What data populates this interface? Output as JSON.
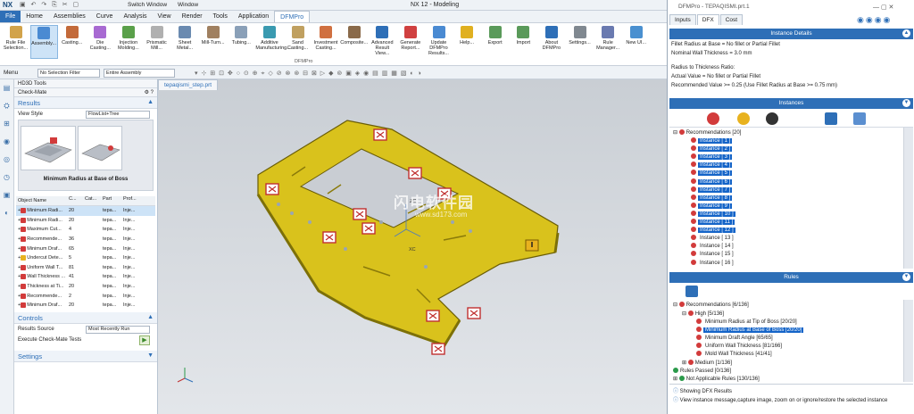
{
  "titlebar": {
    "logo": "NX",
    "switch_window": "Switch Window",
    "window": "Window",
    "title": "NX 12 - Modeling"
  },
  "menu_tabs": [
    "File",
    "Home",
    "Assemblies",
    "Curve",
    "Analysis",
    "View",
    "Render",
    "Tools",
    "Application",
    "DFMPro"
  ],
  "ribbon": {
    "buttons": [
      "Rule File Selection...",
      "Assembly...",
      "Casting...",
      "Die Casting...",
      "Injection Molding...",
      "Prismatic Mill...",
      "Sheet Metal...",
      "Mill-Turn...",
      "Tubing...",
      "Additive Manufacturing...",
      "Sand Casting...",
      "Investment Casting...",
      "Composite...",
      "Advanced Result View...",
      "Generate Report...",
      "Update DFMPro Results...",
      "Help...",
      "Export",
      "Import",
      "About DFMPro",
      "Settings...",
      "Rule Manager...",
      "New UI..."
    ],
    "group_label": "DFMPro"
  },
  "toolbar2": {
    "menu": "Menu",
    "filter": "No Selection Filter",
    "assembly": "Entire Assembly"
  },
  "hd3d": {
    "title": "HD3D Tools",
    "subtitle": "Check-Mate",
    "results_header": "Results",
    "view_style_label": "View Style",
    "view_style_value": "FlowList+Tree",
    "thumb_label": "Minimum Radius at Base of Boss",
    "columns": [
      "Object Name",
      "C...",
      "Cat...",
      "Part",
      "Prof..."
    ],
    "rows": [
      {
        "name": "Minimum Radi...",
        "c": "20",
        "part": "tepa...",
        "prof": "Inje..."
      },
      {
        "name": "Minimum Radi...",
        "c": "20",
        "part": "tepa...",
        "prof": "Inje..."
      },
      {
        "name": "Maximum Cut...",
        "c": "4",
        "part": "tepa...",
        "prof": "Inje..."
      },
      {
        "name": "Recommende...",
        "c": "36",
        "part": "tepa...",
        "prof": "Inje..."
      },
      {
        "name": "Minimum Draf...",
        "c": "65",
        "part": "tepa...",
        "prof": "Inje..."
      },
      {
        "name": "Undercut Dete...",
        "c": "5",
        "part": "tepa...",
        "prof": "Inje..."
      },
      {
        "name": "Uniform Wall T...",
        "c": "81",
        "part": "tepa...",
        "prof": "Inje..."
      },
      {
        "name": "Wall Thickness ...",
        "c": "41",
        "part": "tepa...",
        "prof": "Inje..."
      },
      {
        "name": "Thickness at Ti...",
        "c": "20",
        "part": "tepa...",
        "prof": "Inje..."
      },
      {
        "name": "Recommende...",
        "c": "2",
        "part": "tepa...",
        "prof": "Inje..."
      },
      {
        "name": "Minimum Draf...",
        "c": "20",
        "part": "tepa...",
        "prof": "Inje..."
      }
    ],
    "controls_header": "Controls",
    "results_source_label": "Results Source",
    "results_source_value": "Most Recently Run",
    "execute_label": "Execute Check-Mate Tests",
    "settings_header": "Settings"
  },
  "viewport": {
    "tab": "tepaqismi_step.prt",
    "watermark": "闪电软件园",
    "watermark_url": "www.sd173.com",
    "axis_x": "XC",
    "axis_z": "ZC"
  },
  "dfm": {
    "title": "DFMPro - TEPAQISMI.prt.1",
    "tabs": [
      "Inputs",
      "DFX",
      "Cost"
    ],
    "instance_details_header": "Instance Details",
    "details": [
      "Fillet Radius at Base = No fillet or Partial Fillet",
      "Nominal Wall Thickness = 3.0 mm",
      "Radius to Thickness Ratio:",
      "Actual Value = No fillet or Partial Fillet",
      "Recommended Value >= 0.25 (Use Fillet Radius at Base >= 0.75 mm)"
    ],
    "instances_header": "Instances",
    "rec_root": "Recommendations [20]",
    "instances": [
      "Instance [ 1 ]",
      "Instance [ 2 ]",
      "Instance [ 3 ]",
      "Instance [ 4 ]",
      "Instance [ 5 ]",
      "Instance [ 6 ]",
      "Instance [ 7 ]",
      "Instance [ 8 ]",
      "Instance [ 9 ]",
      "Instance [ 10 ]",
      "Instance [ 11 ]",
      "Instance [ 12 ]",
      "Instance [ 13 ]",
      "Instance [ 14 ]",
      "Instance [ 15 ]",
      "Instance [ 16 ]"
    ],
    "rules_header": "Rules",
    "rules": {
      "root": "Recommendations [6/136]",
      "high": "High [5/136]",
      "items": [
        "Minimum Radius at Tip of Boss [20/20]",
        "Minimum Radius at Base of Boss [20/20]",
        "Minimum Draft Angle [65/65]",
        "Uniform Wall Thickness [81/166]",
        "Mold Wall Thickness [41/41]"
      ],
      "medium": "Medium [1/136]",
      "passed": "Rules Passed [0/136]",
      "na": "Not Applicable Rules [130/136]"
    },
    "status1": "Showing DFX Results",
    "status2": "View instance message,capture image, zoom on or ignore/restore the selected instance"
  }
}
